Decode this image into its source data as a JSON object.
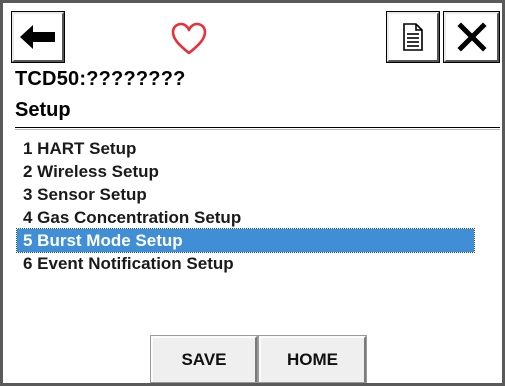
{
  "toolbar": {
    "back_icon": "left-arrow-icon",
    "status_icon": "heart-outline-icon",
    "status_icon_color": "#e8303a",
    "document_icon": "document-icon",
    "close_icon": "close-x-icon"
  },
  "device": {
    "title": "TCD50:????????"
  },
  "menu": {
    "title": "Setup",
    "items": [
      {
        "label": "1 HART Setup"
      },
      {
        "label": "2 Wireless Setup"
      },
      {
        "label": "3 Sensor Setup"
      },
      {
        "label": "4 Gas Concentration Setup"
      },
      {
        "label": "5 Burst Mode Setup",
        "selected": true
      },
      {
        "label": "6 Event Notification Setup"
      }
    ],
    "selection_color": "#3f8ed6"
  },
  "footer": {
    "save_label": "SAVE",
    "home_label": "HOME"
  }
}
